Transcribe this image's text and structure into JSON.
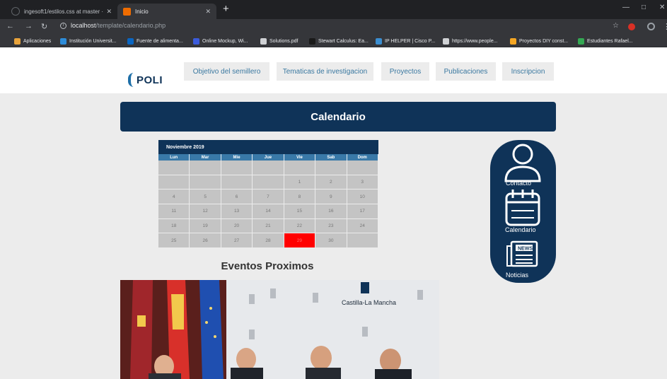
{
  "browser": {
    "tabs": [
      {
        "title": "ingesoft1/estilos.css at master · ",
        "active": false
      },
      {
        "title": "Inicio",
        "active": true
      }
    ],
    "url_host": "localhost",
    "url_path": "/template/calendario.php",
    "bookmarks": [
      {
        "label": "Aplicaciones",
        "icon": "apps-grid-icon",
        "color": "#e8a33b"
      },
      {
        "label": "Institución Universit...",
        "icon": "globe-icon",
        "color": "#2d8cd9"
      },
      {
        "label": "Fuente de alimenta...",
        "icon": "linkedin-icon",
        "color": "#0a66c2"
      },
      {
        "label": "Online Mockup, Wi...",
        "icon": "mockup-icon",
        "color": "#3b5bdb"
      },
      {
        "label": "Solutions.pdf",
        "icon": "github-icon",
        "color": "#cfd1d4"
      },
      {
        "label": "Stewart Calculus: Ea...",
        "icon": "scribd-icon",
        "color": "#1a1a1a"
      },
      {
        "label": "IP HELPER | Cisco P...",
        "icon": "cisco-icon",
        "color": "#3b8ed0"
      },
      {
        "label": "https://www.people...",
        "icon": "github-icon",
        "color": "#cfd1d4"
      },
      {
        "label": "Proyectos DIY const...",
        "icon": "diy-icon",
        "color": "#f5a623"
      },
      {
        "label": "Estudiantes Rafael...",
        "icon": "drive-icon",
        "color": "#34a853"
      }
    ]
  },
  "header": {
    "logo_text": "POLI",
    "nav": [
      "Objetivo del semillero",
      "Tematicas de investigacion",
      "Proyectos",
      "Publicaciones",
      "Inscripcion"
    ]
  },
  "page_title": "Calendario",
  "calendar": {
    "month_label": "Noviembre 2019",
    "weekdays": [
      "Lun",
      "Mar",
      "Mie",
      "Jue",
      "Vie",
      "Sab",
      "Dom"
    ],
    "weeks": [
      [
        "",
        "",
        "",
        "",
        "",
        "",
        ""
      ],
      [
        "",
        "",
        "",
        "",
        "1",
        "2",
        "3"
      ],
      [
        "4",
        "5",
        "6",
        "7",
        "8",
        "9",
        "10"
      ],
      [
        "11",
        "12",
        "13",
        "14",
        "15",
        "16",
        "17"
      ],
      [
        "18",
        "19",
        "20",
        "21",
        "22",
        "23",
        "24"
      ],
      [
        "25",
        "26",
        "27",
        "28",
        "29",
        "30",
        ""
      ]
    ],
    "highlighted_day": "29",
    "highlight_color": "#ff0000"
  },
  "events_title": "Eventos Proximos",
  "event_photo": {
    "banner_text": "Castilla-La Mancha"
  },
  "side_menu": {
    "items": [
      {
        "label": "Contacto",
        "icon": "user-icon"
      },
      {
        "label": "Calendario",
        "icon": "calendar-icon"
      },
      {
        "label": "Noticias",
        "icon": "newspaper-icon",
        "icon_text": "NEWS"
      }
    ]
  },
  "colors": {
    "primary_navy": "#0f3358",
    "weekday_blue": "#3979a8",
    "nav_text": "#3a78a0",
    "page_bg": "#ececec"
  }
}
